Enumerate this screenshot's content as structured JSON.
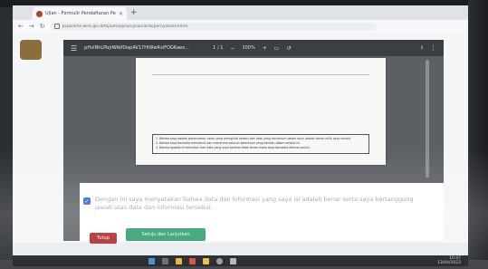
{
  "browser": {
    "tab_title": "Ujian - Formulir Pendaftaran Pesd",
    "url": "pcpsnline.wiro.go.id/fkjaama/psa/cpsa/cards/pernyataan/form"
  },
  "pdf_viewer": {
    "file_name": "pHvlNhLPbjrWAtf0lapAV17HiWwRviFOGKaeo...",
    "page_indicator": "1 / 1",
    "zoom": "100%",
    "document_lines": [
      "1.  Bahwa saya adalah benar-benar calon yang mengikuti seleksi dan data yang tercantum dalam akun adalah benar milik saya sendiri.",
      "2.  Bahwa saya bersedia mematuhi dan menerima seluruh ketentuan yang berlaku dalam seleksi ini.",
      "3.  Bahwa apabila di kemudian hari data yang saya berikan tidak benar maka saya bersedia dikenai sanksi."
    ]
  },
  "statement": {
    "text": "Dengan ini saya menyatakan bahwa data dan informasi yang saya isi adalah benar serta saya bertanggung jawab atas data dan informasi tersebut."
  },
  "actions": {
    "close_label": "Tutup",
    "submit_label": "Setuju dan Lanjutkan"
  },
  "taskbar": {
    "time": "10:47",
    "date": "13/04/2023"
  },
  "colors": {
    "close_button": "#b32626",
    "submit_button": "#2e9d6c",
    "checkbox": "#2b6cd6"
  }
}
